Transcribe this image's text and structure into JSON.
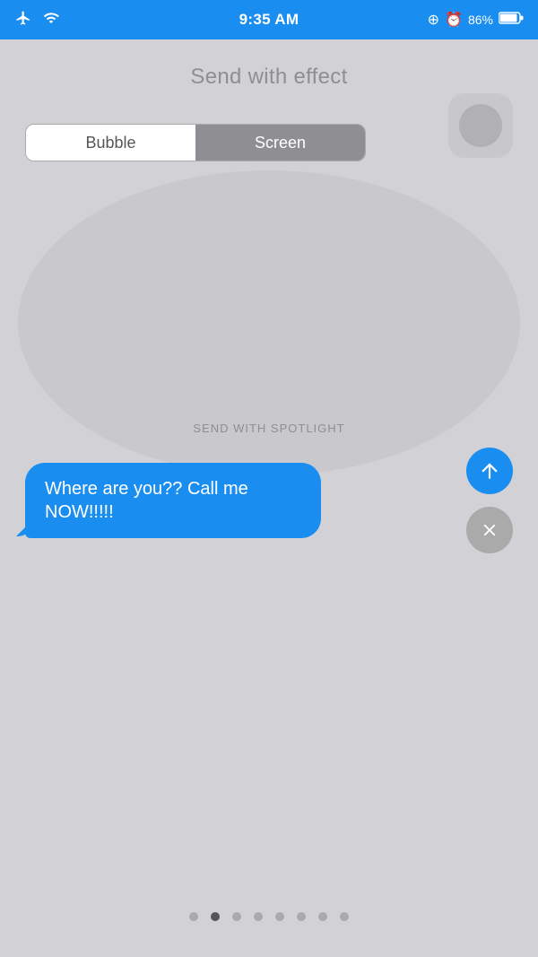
{
  "status_bar": {
    "time": "9:35 AM",
    "battery_percent": "86%"
  },
  "header": {
    "title": "Send with effect"
  },
  "segment_control": {
    "bubble_label": "Bubble",
    "screen_label": "Screen",
    "active_tab": "Screen"
  },
  "spotlight": {
    "label": "SEND WITH SPOTLIGHT",
    "message_text": "Where are you?? Call me NOW!!!!!"
  },
  "actions": {
    "send_arrow": "↑",
    "cancel_x": "✕"
  },
  "pagination": {
    "total_dots": 8,
    "active_dot_index": 1
  }
}
